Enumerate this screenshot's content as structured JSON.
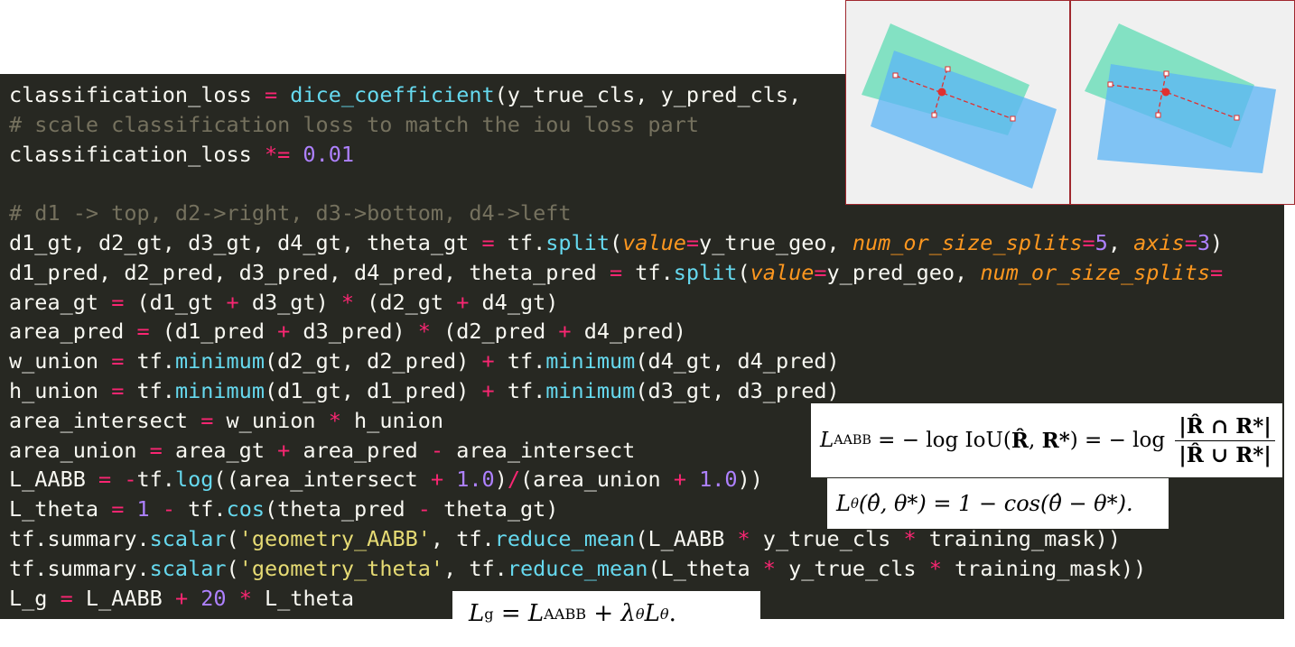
{
  "code_lines": [
    [
      {
        "t": "classification_loss "
      },
      {
        "t": "=",
        "c": "op"
      },
      {
        "t": " "
      },
      {
        "t": "dice_coefficient",
        "c": "fn"
      },
      {
        "t": "(y_true_cls, y_pred_cls,"
      }
    ],
    [
      {
        "t": "# scale classification loss to match the iou loss part",
        "c": "cm"
      }
    ],
    [
      {
        "t": "classification_loss "
      },
      {
        "t": "*=",
        "c": "op"
      },
      {
        "t": " "
      },
      {
        "t": "0.01",
        "c": "num"
      }
    ],
    [
      {
        "t": ""
      }
    ],
    [
      {
        "t": "# d1 -> top, d2->right, d3->bottom, d4->left",
        "c": "cm"
      }
    ],
    [
      {
        "t": "d1_gt, d2_gt, d3_gt, d4_gt, theta_gt "
      },
      {
        "t": "=",
        "c": "op"
      },
      {
        "t": " tf."
      },
      {
        "t": "split",
        "c": "fn"
      },
      {
        "t": "("
      },
      {
        "t": "value",
        "c": "kw"
      },
      {
        "t": "=",
        "c": "op"
      },
      {
        "t": "y_true_geo, "
      },
      {
        "t": "num_or_size_splits",
        "c": "kw"
      },
      {
        "t": "=",
        "c": "op"
      },
      {
        "t": "5",
        "c": "num"
      },
      {
        "t": ", "
      },
      {
        "t": "axis",
        "c": "kw"
      },
      {
        "t": "=",
        "c": "op"
      },
      {
        "t": "3",
        "c": "num"
      },
      {
        "t": ")"
      }
    ],
    [
      {
        "t": "d1_pred, d2_pred, d3_pred, d4_pred, theta_pred "
      },
      {
        "t": "=",
        "c": "op"
      },
      {
        "t": " tf."
      },
      {
        "t": "split",
        "c": "fn"
      },
      {
        "t": "("
      },
      {
        "t": "value",
        "c": "kw"
      },
      {
        "t": "=",
        "c": "op"
      },
      {
        "t": "y_pred_geo, "
      },
      {
        "t": "num_or_size_splits",
        "c": "kw"
      },
      {
        "t": "=",
        "c": "op"
      }
    ],
    [
      {
        "t": "area_gt "
      },
      {
        "t": "=",
        "c": "op"
      },
      {
        "t": " (d1_gt "
      },
      {
        "t": "+",
        "c": "op"
      },
      {
        "t": " d3_gt) "
      },
      {
        "t": "*",
        "c": "op"
      },
      {
        "t": " (d2_gt "
      },
      {
        "t": "+",
        "c": "op"
      },
      {
        "t": " d4_gt)"
      }
    ],
    [
      {
        "t": "area_pred "
      },
      {
        "t": "=",
        "c": "op"
      },
      {
        "t": " (d1_pred "
      },
      {
        "t": "+",
        "c": "op"
      },
      {
        "t": " d3_pred) "
      },
      {
        "t": "*",
        "c": "op"
      },
      {
        "t": " (d2_pred "
      },
      {
        "t": "+",
        "c": "op"
      },
      {
        "t": " d4_pred)"
      }
    ],
    [
      {
        "t": "w_union "
      },
      {
        "t": "=",
        "c": "op"
      },
      {
        "t": " tf."
      },
      {
        "t": "minimum",
        "c": "fn"
      },
      {
        "t": "(d2_gt, d2_pred) "
      },
      {
        "t": "+",
        "c": "op"
      },
      {
        "t": " tf."
      },
      {
        "t": "minimum",
        "c": "fn"
      },
      {
        "t": "(d4_gt, d4_pred)"
      }
    ],
    [
      {
        "t": "h_union "
      },
      {
        "t": "=",
        "c": "op"
      },
      {
        "t": " tf."
      },
      {
        "t": "minimum",
        "c": "fn"
      },
      {
        "t": "(d1_gt, d1_pred) "
      },
      {
        "t": "+",
        "c": "op"
      },
      {
        "t": " tf."
      },
      {
        "t": "minimum",
        "c": "fn"
      },
      {
        "t": "(d3_gt, d3_pred)"
      }
    ],
    [
      {
        "t": "area_intersect "
      },
      {
        "t": "=",
        "c": "op"
      },
      {
        "t": " w_union "
      },
      {
        "t": "*",
        "c": "op"
      },
      {
        "t": " h_union"
      }
    ],
    [
      {
        "t": "area_union "
      },
      {
        "t": "=",
        "c": "op"
      },
      {
        "t": " area_gt "
      },
      {
        "t": "+",
        "c": "op"
      },
      {
        "t": " area_pred "
      },
      {
        "t": "-",
        "c": "op"
      },
      {
        "t": " area_intersect"
      }
    ],
    [
      {
        "t": "L_AABB "
      },
      {
        "t": "=",
        "c": "op"
      },
      {
        "t": " "
      },
      {
        "t": "-",
        "c": "op"
      },
      {
        "t": "tf."
      },
      {
        "t": "log",
        "c": "fn"
      },
      {
        "t": "((area_intersect "
      },
      {
        "t": "+",
        "c": "op"
      },
      {
        "t": " "
      },
      {
        "t": "1.0",
        "c": "num"
      },
      {
        "t": ")"
      },
      {
        "t": "/",
        "c": "op"
      },
      {
        "t": "(area_union "
      },
      {
        "t": "+",
        "c": "op"
      },
      {
        "t": " "
      },
      {
        "t": "1.0",
        "c": "num"
      },
      {
        "t": "))"
      }
    ],
    [
      {
        "t": "L_theta "
      },
      {
        "t": "=",
        "c": "op"
      },
      {
        "t": " "
      },
      {
        "t": "1",
        "c": "num"
      },
      {
        "t": " "
      },
      {
        "t": "-",
        "c": "op"
      },
      {
        "t": " tf."
      },
      {
        "t": "cos",
        "c": "fn"
      },
      {
        "t": "(theta_pred "
      },
      {
        "t": "-",
        "c": "op"
      },
      {
        "t": " theta_gt)"
      }
    ],
    [
      {
        "t": "tf.summary."
      },
      {
        "t": "scalar",
        "c": "fn"
      },
      {
        "t": "("
      },
      {
        "t": "'geometry_AABB'",
        "c": "str"
      },
      {
        "t": ", tf."
      },
      {
        "t": "reduce_mean",
        "c": "fn"
      },
      {
        "t": "(L_AABB "
      },
      {
        "t": "*",
        "c": "op"
      },
      {
        "t": " y_true_cls "
      },
      {
        "t": "*",
        "c": "op"
      },
      {
        "t": " training_mask))"
      }
    ],
    [
      {
        "t": "tf.summary."
      },
      {
        "t": "scalar",
        "c": "fn"
      },
      {
        "t": "("
      },
      {
        "t": "'geometry_theta'",
        "c": "str"
      },
      {
        "t": ", tf."
      },
      {
        "t": "reduce_mean",
        "c": "fn"
      },
      {
        "t": "(L_theta "
      },
      {
        "t": "*",
        "c": "op"
      },
      {
        "t": " y_true_cls "
      },
      {
        "t": "*",
        "c": "op"
      },
      {
        "t": " training_mask))"
      }
    ],
    [
      {
        "t": "L_g "
      },
      {
        "t": "=",
        "c": "op"
      },
      {
        "t": " L_AABB "
      },
      {
        "t": "+",
        "c": "op"
      },
      {
        "t": " "
      },
      {
        "t": "20",
        "c": "num"
      },
      {
        "t": " "
      },
      {
        "t": "*",
        "c": "op"
      },
      {
        "t": " L_theta"
      }
    ]
  ],
  "formulas": {
    "aabb": {
      "lhs": "L",
      "lhs_sub": "AABB",
      "eq1": " = − log IoU(",
      "r_hat": "R̂",
      "comma": ", ",
      "r_star": "R*",
      "eq2": ") = − log ",
      "numerator": "|R̂ ∩ R*|",
      "denominator": "|R̂ ∪ R*|"
    },
    "theta": {
      "lhs": "L",
      "lhs_sub": "θ",
      "args": "(θ̂, θ*) = 1 − cos(θ̂ − θ*)."
    },
    "total": {
      "lhs": "L",
      "lhs_sub": "g",
      "mid": " = L",
      "mid_sub": "AABB",
      "plus": " + λ",
      "lambda_sub": "θ",
      "tail": "L",
      "tail_sub": "θ",
      "end": "."
    }
  },
  "colors": {
    "editor_bg": "#272822",
    "gt_box": "#5fdcb4",
    "pred_box": "#5bb4f5",
    "distance_lines": "#e03030",
    "thumb_border": "#a0282e"
  }
}
